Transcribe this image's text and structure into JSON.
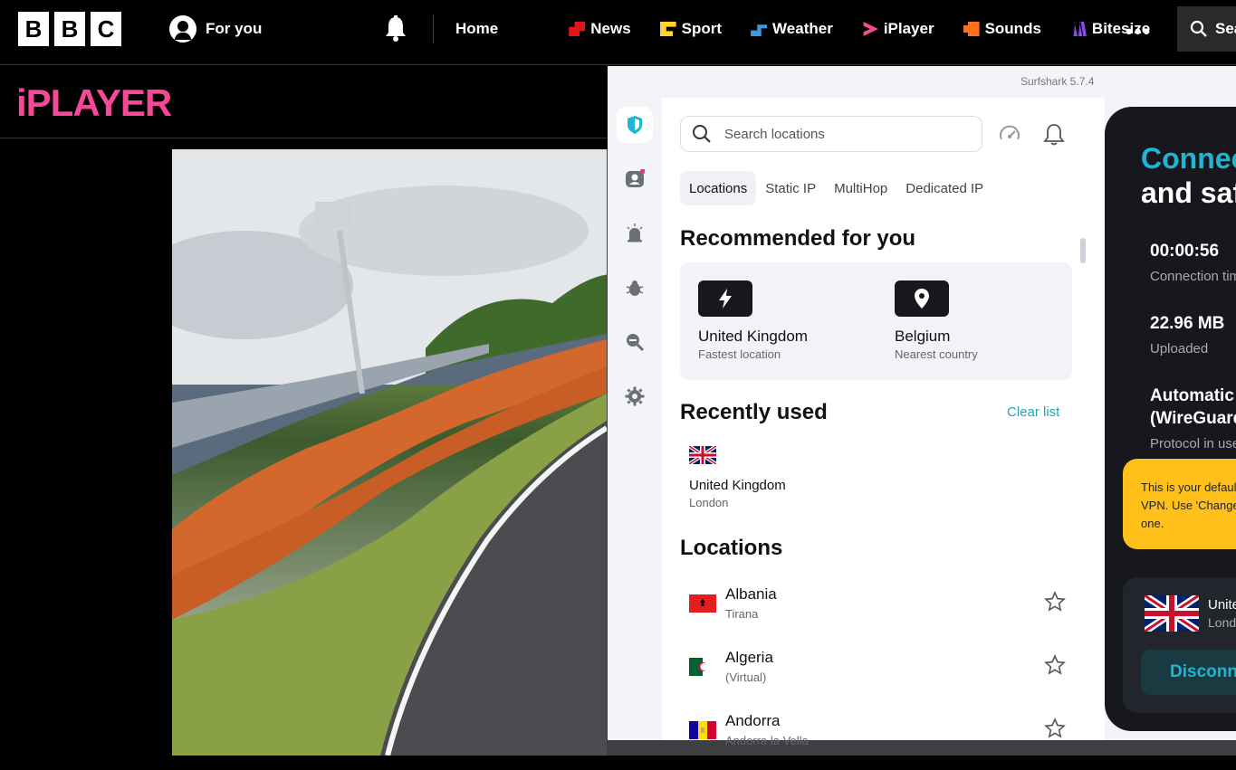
{
  "bbc": {
    "logo": [
      "B",
      "B",
      "C"
    ],
    "for_you": "For you",
    "nav": [
      {
        "label": "Home",
        "color": ""
      },
      {
        "label": "News",
        "color": "#e4141b"
      },
      {
        "label": "Sport",
        "color": "#ffd230"
      },
      {
        "label": "Weather",
        "color": "#3a9ad9"
      },
      {
        "label": "iPlayer",
        "color": "#f54997"
      },
      {
        "label": "Sounds",
        "color": "#ff6e1f"
      },
      {
        "label": "Bitesize",
        "color": "#8a49e8"
      }
    ],
    "search_label": "Sea"
  },
  "iplayer": {
    "logo": "iPLAYER",
    "accent": "#f54997"
  },
  "surfshark": {
    "version": "Surfshark 5.7.4",
    "search_placeholder": "Search locations",
    "tabs": [
      "Locations",
      "Static IP",
      "MultiHop",
      "Dedicated IP"
    ],
    "recommended_title": "Recommended for you",
    "recommended": [
      {
        "name": "United Kingdom",
        "sub": "Fastest location",
        "icon": "lightning-icon"
      },
      {
        "name": "Belgium",
        "sub": "Nearest country",
        "icon": "location-pin-icon"
      }
    ],
    "recent_title": "Recently used",
    "clear_list": "Clear list",
    "recent": {
      "name": "United Kingdom",
      "sub": "London"
    },
    "locations_title": "Locations",
    "locations": [
      {
        "name": "Albania",
        "sub": "Tirana"
      },
      {
        "name": "Algeria",
        "sub": "(Virtual)"
      },
      {
        "name": "Andorra",
        "sub": "Andorra la Vella"
      }
    ],
    "panel": {
      "title_line1": "Connected",
      "title_line2": "and safe",
      "time_value": "00:00:56",
      "time_label": "Connection time",
      "upload_value": "22.96 MB",
      "upload_label": "Uploaded",
      "protocol_value_1": "Automatic",
      "protocol_value_2": "(WireGuard)",
      "protocol_label": "Protocol in use",
      "tip_1": "This is your default",
      "tip_2": "VPN. Use 'Change'",
      "tip_3": "one.",
      "card_name": "United Kingdom",
      "card_sub": "London",
      "disconnect": "Disconnect"
    },
    "accent": "#1eb6d2"
  }
}
